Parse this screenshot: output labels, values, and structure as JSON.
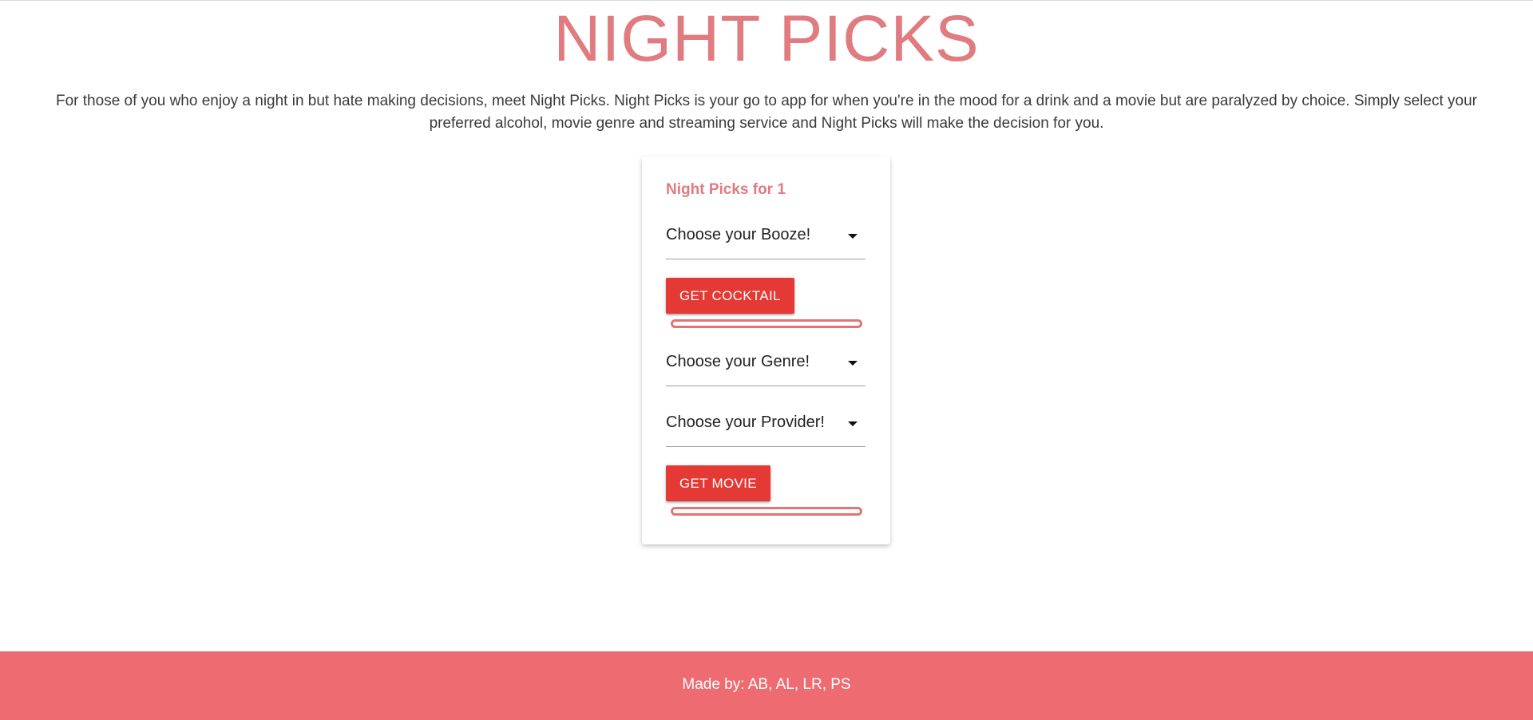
{
  "header": {
    "title": "NIGHT PICKS",
    "intro": "For those of you who enjoy a night in but hate making decisions, meet Night Picks. Night Picks is your go to app for when you're in the mood for a drink and a movie but are paralyzed by choice. Simply select your preferred alcohol, movie genre and streaming service and Night Picks will make the decision for you."
  },
  "card": {
    "title": "Night Picks for 1",
    "booze_select": {
      "selected": "Choose your Booze!"
    },
    "cocktail_button": "GET COCKTAIL",
    "cocktail_progress": 0,
    "genre_select": {
      "selected": "Choose your Genre!"
    },
    "provider_select": {
      "selected": "Choose your Provider!"
    },
    "movie_button": "GET MOVIE",
    "movie_progress": 0
  },
  "footer": {
    "text": "Made by: AB, AL, LR, PS"
  },
  "colors": {
    "accent": "#e07b80",
    "button": "#e53935",
    "footer": "#ef6b72"
  }
}
